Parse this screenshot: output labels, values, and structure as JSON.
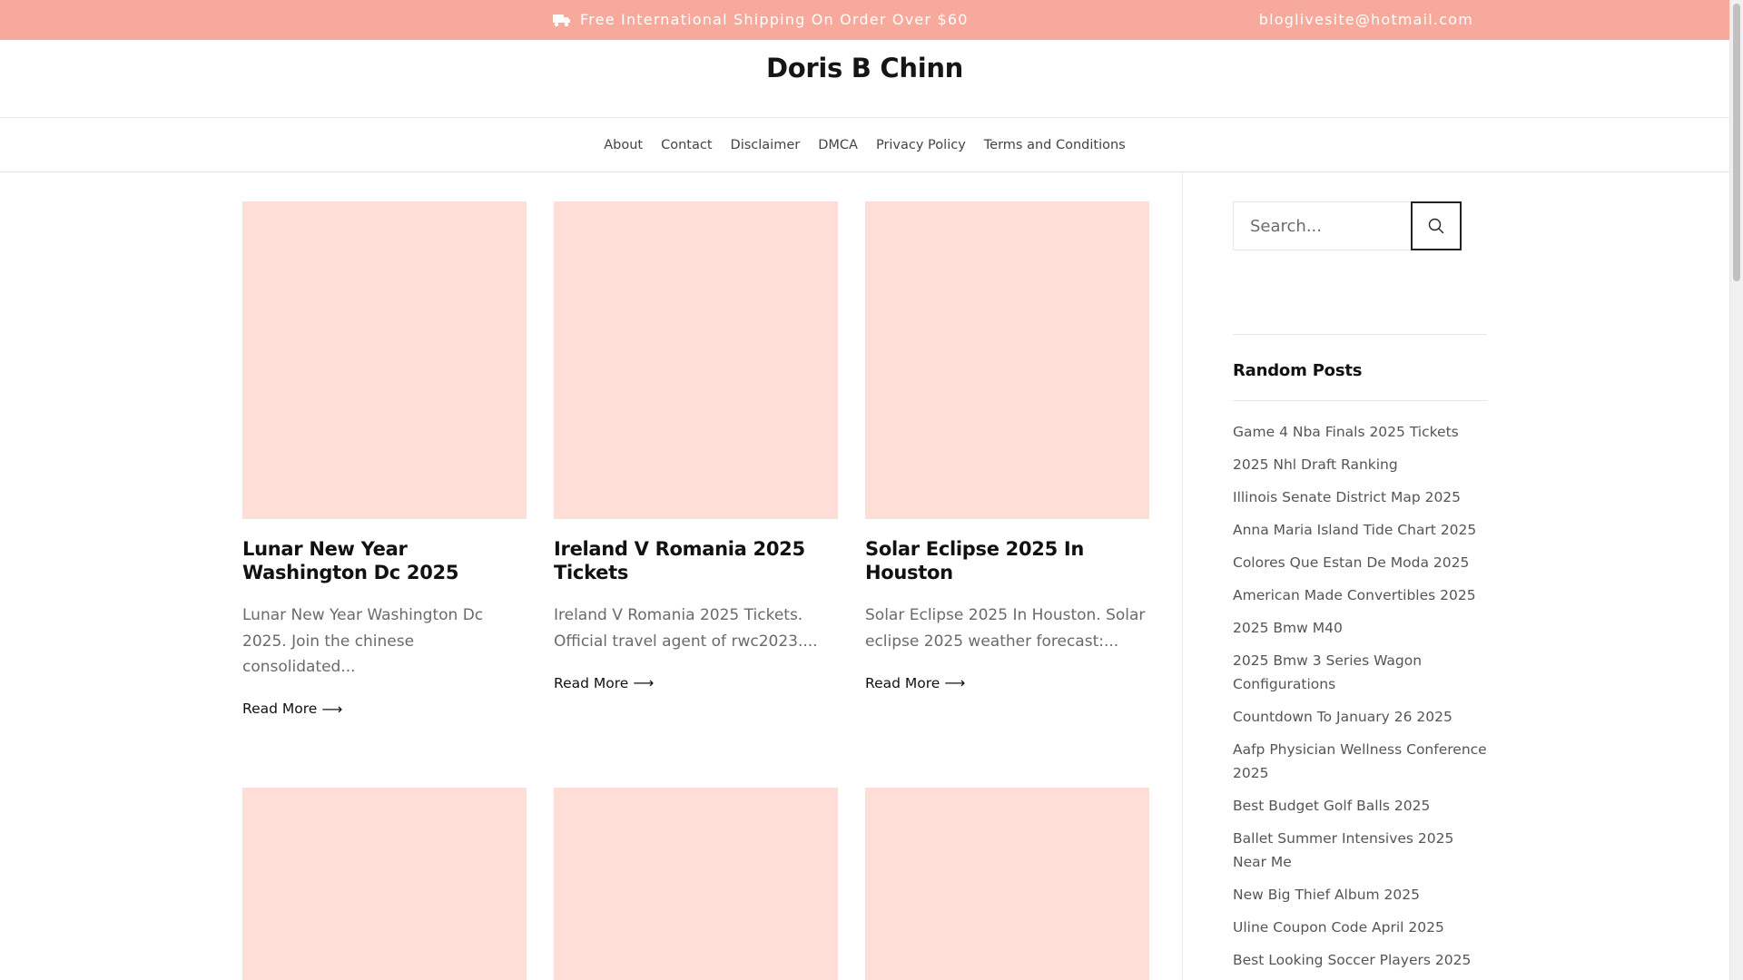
{
  "topbar": {
    "icon": "truck-icon",
    "shipping_text": "Free International Shipping On Order Over $60",
    "email": "bloglivesite@hotmail.com",
    "background_color": "#f7a99c"
  },
  "site": {
    "title": "Doris B Chinn"
  },
  "nav": {
    "items": [
      "About",
      "Contact",
      "Disclaimer",
      "DMCA",
      "Privacy Policy",
      "Terms and Conditions"
    ]
  },
  "posts": [
    {
      "title": "Lunar New Year Washington Dc 2025",
      "excerpt": "Lunar New Year Washington Dc 2025. Join the chinese consolidated...",
      "read_more": "Read More"
    },
    {
      "title": "Ireland V Romania 2025 Tickets",
      "excerpt": "Ireland V Romania 2025 Tickets. Official travel agent of rwc2023....",
      "read_more": "Read More"
    },
    {
      "title": "Solar Eclipse 2025 In Houston",
      "excerpt": "Solar Eclipse 2025 In Houston. Solar eclipse 2025 weather forecast:...",
      "read_more": "Read More"
    }
  ],
  "thumbnail_color": "#ffded7",
  "sidebar": {
    "search": {
      "placeholder": "Search...",
      "value": "",
      "button_icon": "search-icon"
    },
    "random_posts": {
      "heading": "Random Posts",
      "items": [
        "Game 4 Nba Finals 2025 Tickets",
        "2025 Nhl Draft Ranking",
        "Illinois Senate District Map 2025",
        "Anna Maria Island Tide Chart 2025",
        "Colores Que Estan De Moda 2025",
        "American Made Convertibles 2025",
        "2025 Bmw M40",
        "2025 Bmw 3 Series Wagon Configurations",
        "Countdown To January 26 2025",
        "Aafp Physician Wellness Conference 2025",
        "Best Budget Golf Balls 2025",
        "Ballet Summer Intensives 2025 Near Me",
        "New Big Thief Album 2025",
        "Uline Coupon Code April 2025",
        "Best Looking Soccer Players 2025"
      ]
    }
  }
}
